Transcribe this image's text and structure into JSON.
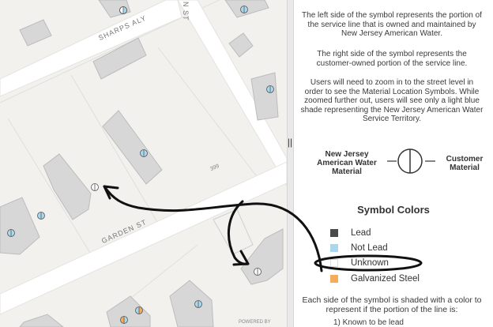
{
  "map": {
    "streets": {
      "sharps_aly": "SHARPS ALY",
      "garden_st": "GARDEN ST",
      "n_st_fragment": "N ST"
    },
    "address_number": "399",
    "attribution": "POWERED BY",
    "symbol_icon": "split-circle-icon"
  },
  "panel": {
    "para_left": "The left side of the symbol represents the portion of the service line that is owned and maintained by New Jersey American Water.",
    "para_right": "The right side of the symbol represents the customer-owned portion of the service line.",
    "para_zoom": "Users will need to zoom in to the street level in order to see the Material Location Symbols. While zoomed further out, users will see only a light blue shade representing the New Jersey American Water Service Territory.",
    "diagram": {
      "left_label_line1": "New Jersey",
      "left_label_line2": "American Water",
      "left_label_line3": "Material",
      "right_label_line1": "Customer",
      "right_label_line2": "Material"
    },
    "colors_title": "Symbol Colors",
    "legend": [
      {
        "label": "Lead",
        "color": "#4a4a4a"
      },
      {
        "label": "Not Lead",
        "color": "#a9d8ee"
      },
      {
        "label": "Unknown",
        "color": "#ffffff"
      },
      {
        "label": "Galvanized Steel",
        "color": "#f6ad5a"
      }
    ],
    "para_shade": "Each side of the symbol is shaded with a color to represent if the portion of the line is:",
    "list_item_1": "1)  Known to be lead"
  },
  "divider_handle": "||"
}
